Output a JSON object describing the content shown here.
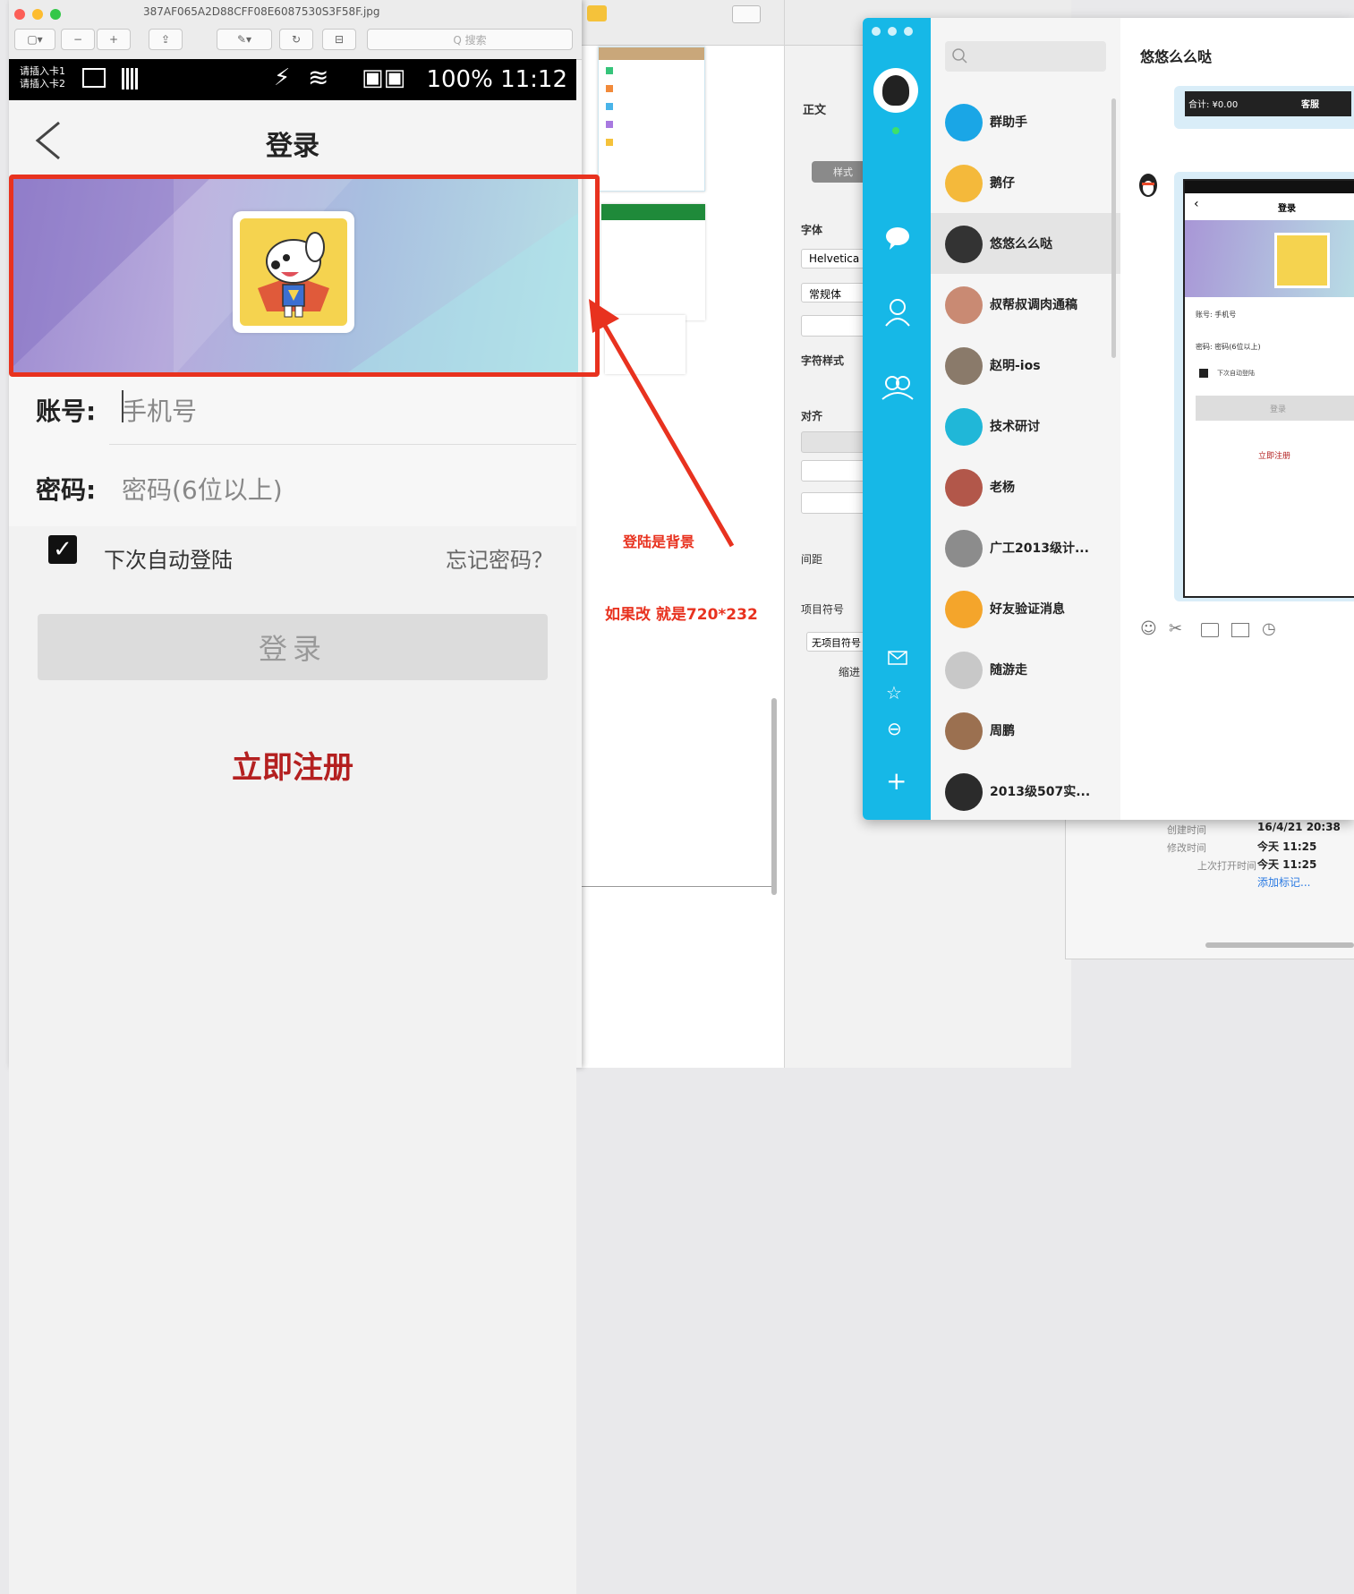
{
  "preview_window": {
    "file_title": "387AF065A2D88CFF08E6087530S3F58F.jpg",
    "search_placeholder": "Q 搜索"
  },
  "phone": {
    "status_sim1": "请插入卡1",
    "status_sim2": "请插入卡2",
    "status_right": "100% 11:12",
    "nav_title": "登录",
    "account_label": "账号:",
    "account_placeholder": "手机号",
    "password_label": "密码:",
    "password_placeholder": "密码(6位以上)",
    "auto_login": "下次自动登陆",
    "forgot_password": "忘记密码？",
    "login_button": "登录",
    "register_link": "立即注册"
  },
  "annotation": {
    "note1": "登陆是背景",
    "note2": "如果改 就是720*232"
  },
  "inspector": {
    "tab_body": "正文",
    "style_btn": "样式",
    "font_label": "字体",
    "font_value": "Helvetica",
    "font_weight": "常规体",
    "char_style": "字符样式",
    "align_label": "对齐",
    "spacing_label": "间距",
    "bullets_label": "项目符号",
    "bullets_value": "无项目符号",
    "indent_label": "缩进"
  },
  "file_info": {
    "created_label": "创建时间",
    "created_value": "16/4/21 20:38",
    "modified_label": "修改时间",
    "modified_value": "今天 11:25",
    "opened_label": "上次打开时间",
    "opened_value": "今天 11:25",
    "add_tag": "添加标记..."
  },
  "qq": {
    "chat_title": "悠悠么么哒",
    "contacts": [
      {
        "name": "群助手",
        "color": "#1aa6e6"
      },
      {
        "name": "鹅仔",
        "color": "#f4b93b"
      },
      {
        "name": "悠悠么么哒",
        "color": "#333333"
      },
      {
        "name": "叔帮叔调肉通稿",
        "color": "#c98a73"
      },
      {
        "name": "赵明-ios",
        "color": "#8a7a6a"
      },
      {
        "name": "技术研讨",
        "color": "#20b7d8"
      },
      {
        "name": "老杨",
        "color": "#b2574a"
      },
      {
        "name": "广工2013级计...",
        "color": "#8c8c8c"
      },
      {
        "name": "好友验证消息",
        "color": "#f4a52b"
      },
      {
        "name": "随游走",
        "color": "#c8c8c8"
      },
      {
        "name": "周鹏",
        "color": "#9b7050"
      },
      {
        "name": "2013级507实...",
        "color": "#2b2b2b"
      }
    ],
    "preview_login": {
      "title": "登录",
      "account": "账号: 手机号",
      "password": "密码: 密码(6位以上)",
      "auto": "下次自动登陆",
      "login": "登录",
      "register": "立即注册"
    },
    "top_msg_left": "合计: ¥0.00",
    "top_msg_right": "客服"
  }
}
